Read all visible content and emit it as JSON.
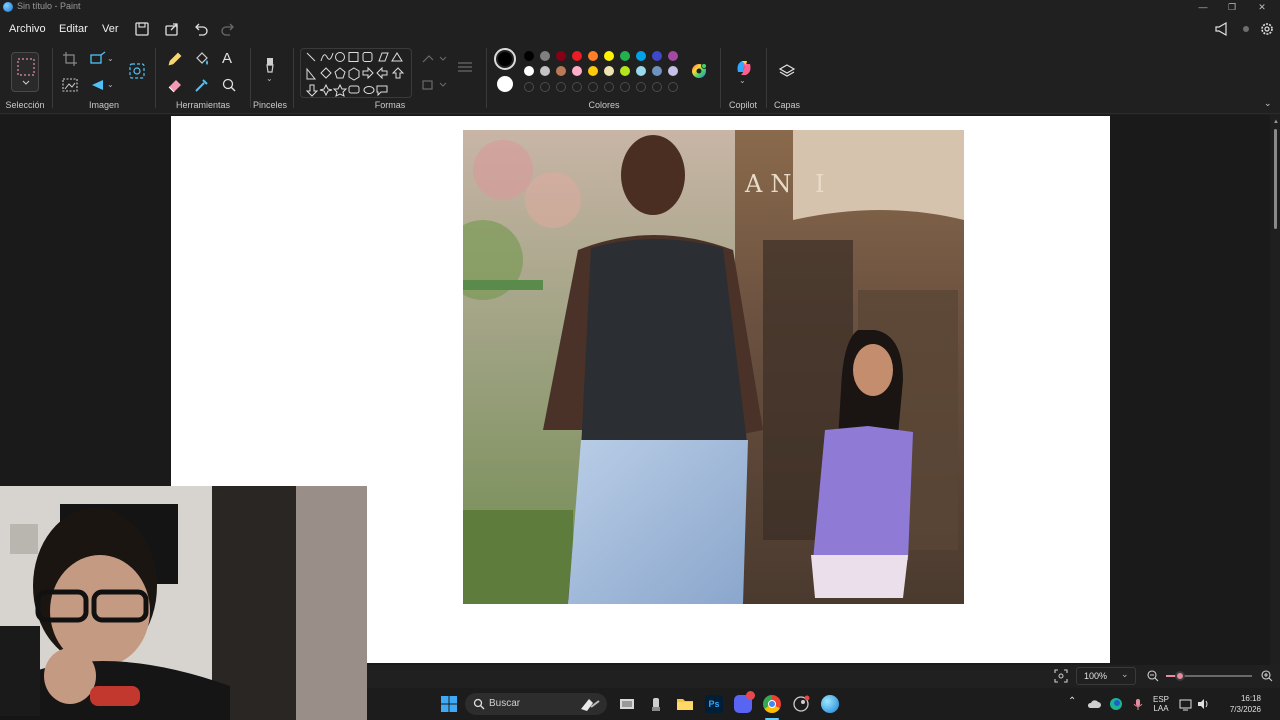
{
  "window": {
    "title": "Sin título - Paint",
    "app_icon": "paint-icon"
  },
  "menu": {
    "items": [
      "Archivo",
      "Editar",
      "Ver"
    ],
    "save_icon": "save-icon",
    "share_icon": "share-icon",
    "undo_icon": "undo-icon",
    "redo_icon": "redo-icon",
    "right_icons": [
      "announce-icon",
      "profile-icon",
      "settings-icon"
    ]
  },
  "ribbon": {
    "groups": {
      "selection": "Selección",
      "image": "Imagen",
      "tools": "Herramientas",
      "brushes": "Pinceles",
      "shapes": "Formas",
      "colors": "Colores",
      "copilot": "Copilot",
      "layers": "Capas"
    },
    "colors": {
      "primary": "#000000",
      "secondary": "#ffffff",
      "palette_row1": [
        "#000000",
        "#7f7f7f",
        "#880015",
        "#ed1c24",
        "#ff7f27",
        "#fff200",
        "#22b14c",
        "#00a2e8",
        "#3f48cc",
        "#a349a4"
      ],
      "palette_row2": [
        "#ffffff",
        "#c3c3c3",
        "#b97a57",
        "#ffaec9",
        "#ffc90e",
        "#efe4b0",
        "#b5e61d",
        "#99d9ea",
        "#7092be",
        "#c8bfe7"
      ]
    }
  },
  "status": {
    "zoom": "100%"
  },
  "taskbar": {
    "search_placeholder": "Buscar",
    "lang_top": "ESP",
    "lang_bottom": "LAA",
    "time": "16:18",
    "date": "7/3/2026"
  }
}
